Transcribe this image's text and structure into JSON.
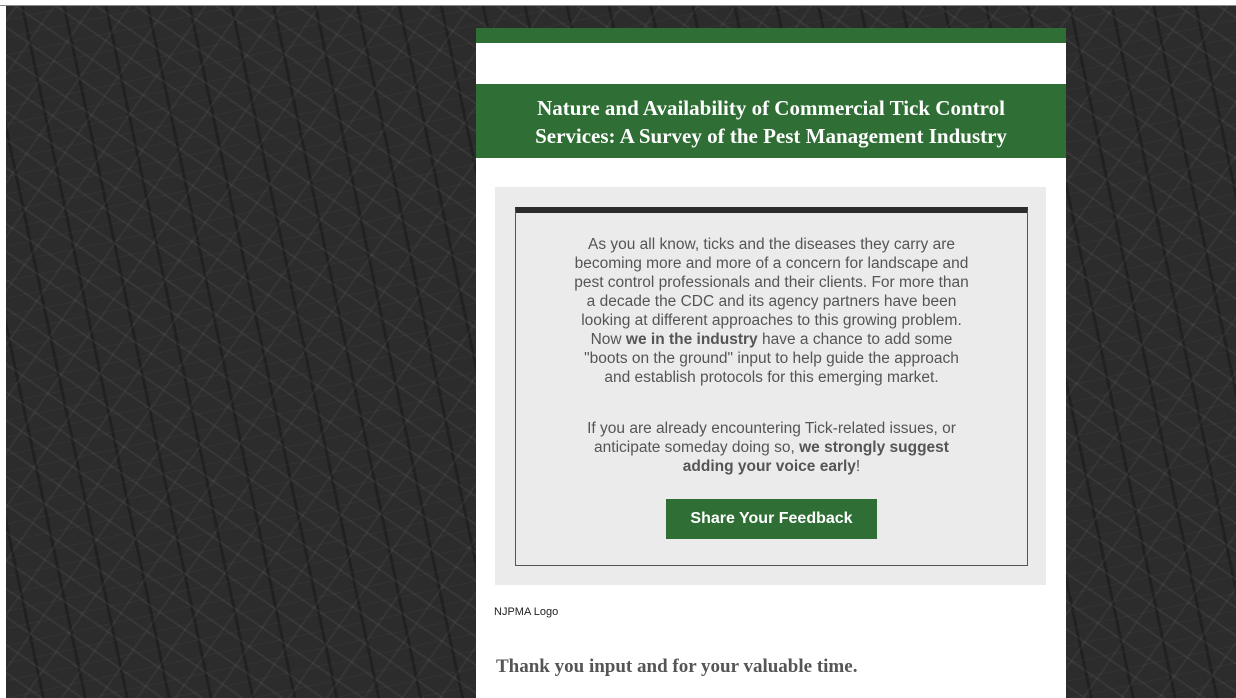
{
  "email": {
    "title_line1": "Nature and Availability of Commercial Tick Control",
    "title_line2": "Services:  A Survey of the Pest Management Industry",
    "paragraph1": {
      "l1": "As you all know, ticks and the diseases they carry are",
      "l2": "becoming more and more of a concern for landscape and",
      "l3": "pest control professionals and their clients.  For more than",
      "l4": "a decade the CDC and its agency partners have been",
      "l5": "looking at different approaches to this growing problem.",
      "l6_pre": "Now ",
      "l6_bold": "we in the industry",
      "l6_post": " have a chance to add some",
      "l7": "\"boots on the ground\" input to help guide the approach",
      "l8": "and establish protocols for this emerging market."
    },
    "paragraph2": {
      "l1": "If you are already encountering Tick-related issues, or",
      "l2_pre": "anticipate someday doing so, ",
      "l2_bold": "we strongly suggest",
      "l3_bold": "adding your voice early",
      "l3_post": "!"
    },
    "cta_label": "Share Your Feedback",
    "logo_alt": "NJPMA Logo",
    "thanks": "Thank you input and for your valuable time."
  },
  "colors": {
    "brand_green": "#2f6e34",
    "panel_gray": "#ebebeb",
    "text_gray": "#555555",
    "background": "#2c2c2c"
  }
}
